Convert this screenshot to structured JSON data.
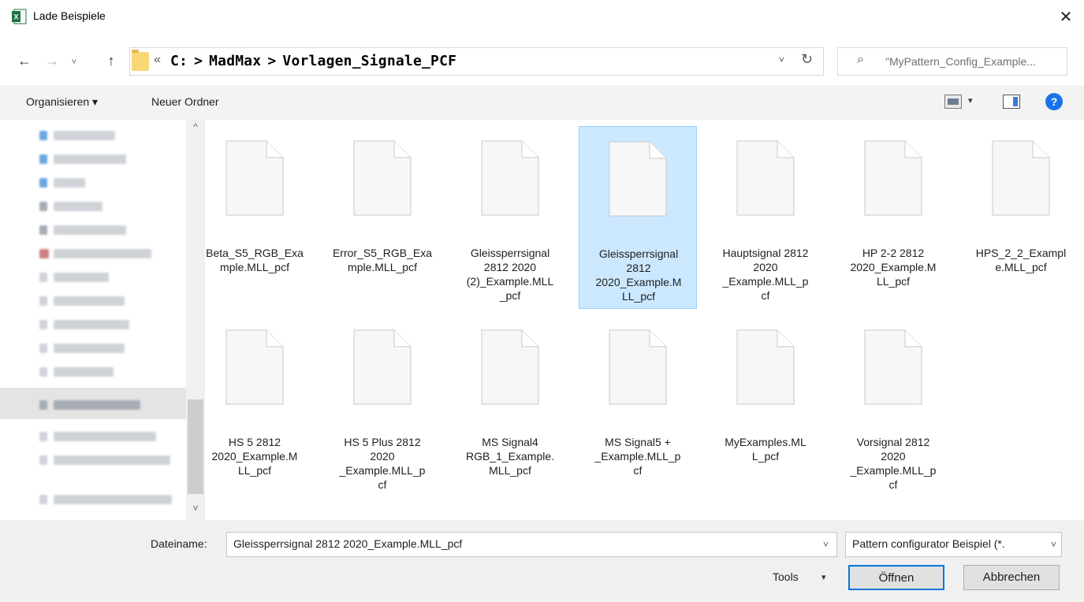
{
  "window": {
    "title": "Lade Beispiele",
    "app_icon": "excel-icon",
    "close_glyph": "✕"
  },
  "nav": {
    "back_glyph": "←",
    "forward_glyph": "→",
    "recent_glyph": "˅",
    "up_glyph": "↑",
    "more_glyph": "«",
    "breadcrumb": [
      "C:",
      "MadMax",
      "Vorlagen_Signale_PCF"
    ],
    "separator": ">",
    "dropdown_glyph": "˅",
    "refresh_glyph": "↻",
    "search_glyph": "⌕",
    "search_text": "\"MyPattern_Config_Example..."
  },
  "toolbar": {
    "organize_label": "Organisieren ▾",
    "new_folder_label": "Neuer Ordner",
    "view_dropdown_glyph": "▾",
    "help_glyph": "?"
  },
  "sidebar": {
    "scroll_up_glyph": "^",
    "scroll_down_glyph": "˅"
  },
  "files": [
    {
      "name": "Beta_S5_RGB_Example.MLL_pcf",
      "selected": false
    },
    {
      "name": "Error_S5_RGB_Example.MLL_pcf",
      "selected": false
    },
    {
      "name": "Gleissperrsignal 2812 2020 (2)_Example.MLL_pcf",
      "selected": false
    },
    {
      "name": "Gleissperrsignal 2812 2020_Example.MLL_pcf",
      "selected": true
    },
    {
      "name": "Hauptsignal 2812 2020 _Example.MLL_pcf",
      "selected": false
    },
    {
      "name": "HP 2-2 2812 2020_Example.MLL_pcf",
      "selected": false
    },
    {
      "name": "HPS_2_2_Example.MLL_pcf",
      "selected": false
    },
    {
      "name": "HS 5 2812 2020_Example.MLL_pcf",
      "selected": false
    },
    {
      "name": "HS 5 Plus 2812 2020 _Example.MLL_pcf",
      "selected": false
    },
    {
      "name": "MS Signal4 RGB_1_Example.MLL_pcf",
      "selected": false
    },
    {
      "name": "MS Signal5 + _Example.MLL_pcf",
      "selected": false
    },
    {
      "name": "MyExamples.MLL_pcf",
      "selected": false
    },
    {
      "name": "Vorsignal 2812 2020 _Example.MLL_pcf",
      "selected": false
    }
  ],
  "file_display_lines": [
    [
      "Beta_S5_RGB_Exa",
      "mple.MLL_pcf"
    ],
    [
      "Error_S5_RGB_Exa",
      "mple.MLL_pcf"
    ],
    [
      "Gleissperrsignal",
      "2812 2020",
      "(2)_Example.MLL",
      "_pcf"
    ],
    [
      "Gleissperrsignal",
      "2812",
      "2020_Example.M",
      "LL_pcf"
    ],
    [
      "Hauptsignal 2812",
      "2020",
      "_Example.MLL_p",
      "cf"
    ],
    [
      "HP 2-2 2812",
      "2020_Example.M",
      "LL_pcf"
    ],
    [
      "HPS_2_2_Exampl",
      "e.MLL_pcf"
    ],
    [
      "HS 5 2812",
      "2020_Example.M",
      "LL_pcf"
    ],
    [
      "HS 5 Plus 2812",
      "2020",
      "_Example.MLL_p",
      "cf"
    ],
    [
      "MS Signal4",
      "RGB_1_Example.",
      "MLL_pcf"
    ],
    [
      "MS Signal5 +",
      "_Example.MLL_p",
      "cf"
    ],
    [
      "MyExamples.ML",
      "L_pcf"
    ],
    [
      "Vorsignal 2812",
      "2020",
      "_Example.MLL_p",
      "cf"
    ]
  ],
  "footer": {
    "filename_label": "Dateiname:",
    "filename_value": "Gleissperrsignal 2812 2020_Example.MLL_pcf",
    "filename_drop_glyph": "˅",
    "filter_value": "Pattern configurator Beispiel (*.",
    "filter_drop_glyph": "˅",
    "tools_label": "Tools",
    "tools_drop_glyph": "▾",
    "open_label": "Öffnen",
    "cancel_label": "Abbrechen"
  },
  "colors": {
    "selection_fill": "#cce8ff",
    "selection_border": "#99d1ff",
    "primary_button_border": "#0078d7",
    "excel_green": "#1e7145"
  }
}
